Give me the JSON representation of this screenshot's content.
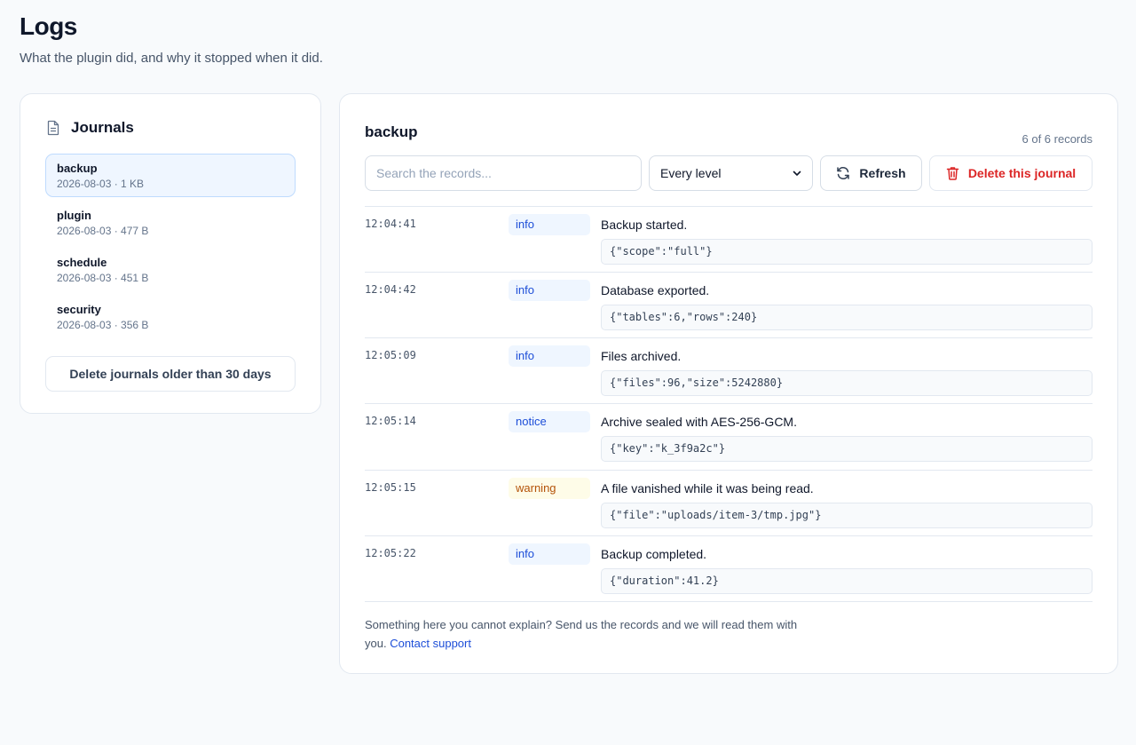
{
  "page": {
    "title": "Logs",
    "subtitle": "What the plugin did, and why it stopped when it did."
  },
  "sidebar": {
    "title": "Journals",
    "icon": "file-text-icon",
    "journals": [
      {
        "name": "backup",
        "meta": "2026-08-03 · 1 KB",
        "active": true
      },
      {
        "name": "plugin",
        "meta": "2026-08-03 · 477 B",
        "active": false
      },
      {
        "name": "schedule",
        "meta": "2026-08-03 · 451 B",
        "active": false
      },
      {
        "name": "security",
        "meta": "2026-08-03 · 356 B",
        "active": false
      }
    ],
    "purge_label": "Delete journals older than 30 days"
  },
  "main": {
    "journal_title": "backup",
    "record_count": "6 of 6 records",
    "search": {
      "placeholder": "Search the records...",
      "value": ""
    },
    "level_filter": {
      "selected": "Every level"
    },
    "refresh_label": "Refresh",
    "delete_label": "Delete this journal",
    "records": [
      {
        "time": "12:04:41",
        "level": "info",
        "message": "Backup started.",
        "context": "{\"scope\":\"full\"}"
      },
      {
        "time": "12:04:42",
        "level": "info",
        "message": "Database exported.",
        "context": "{\"tables\":6,\"rows\":240}"
      },
      {
        "time": "12:05:09",
        "level": "info",
        "message": "Files archived.",
        "context": "{\"files\":96,\"size\":5242880}"
      },
      {
        "time": "12:05:14",
        "level": "notice",
        "message": "Archive sealed with AES-256-GCM.",
        "context": "{\"key\":\"k_3f9a2c\"}"
      },
      {
        "time": "12:05:15",
        "level": "warning",
        "message": "A file vanished while it was being read.",
        "context": "{\"file\":\"uploads/item-3/tmp.jpg\"}"
      },
      {
        "time": "12:05:22",
        "level": "info",
        "message": "Backup completed.",
        "context": "{\"duration\":41.2}"
      }
    ],
    "footer": {
      "text": "Something here you cannot explain? Send us the records and we will read them with you.",
      "link_label": "Contact support"
    }
  },
  "colors": {
    "accent": "#1d4ed8",
    "danger": "#dc2626",
    "warning": "#b45309",
    "active_bg": "#eff6ff"
  }
}
